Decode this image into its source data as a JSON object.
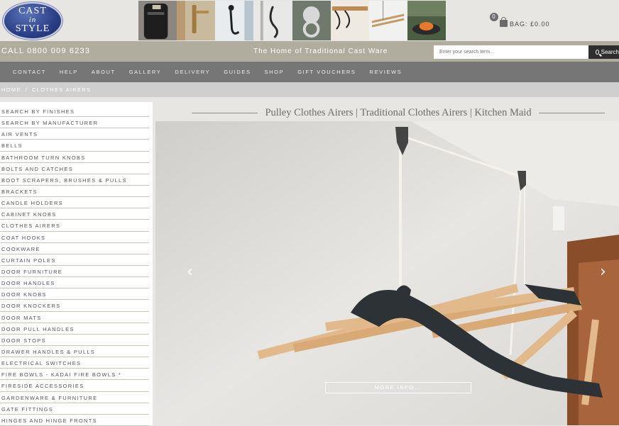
{
  "logo": {
    "line1": "CAST",
    "line2": "in",
    "line3": "STYLE"
  },
  "bag": {
    "count": "0",
    "label": "BAG: £0.00"
  },
  "strip": {
    "phone": "CALL 0800 009 6233",
    "tagline": "The Home of Traditional Cast Ware",
    "search_placeholder": "Enter your search term...",
    "search_button": "Search"
  },
  "nav": [
    "CONTACT",
    "HELP",
    "ABOUT",
    "GALLERY",
    "DELIVERY",
    "GUIDES",
    "SHOP",
    "GIFT VOUCHERS",
    "REVIEWS"
  ],
  "breadcrumb": {
    "home": "HOME",
    "sep": "/",
    "current": "CLOTHES AIRERS"
  },
  "sidebar": [
    "SEARCH BY FINISHES",
    "SEARCH BY MANUFACTURER",
    "AIR VENTS",
    "BELLS",
    "BATHROOM TURN KNOBS",
    "BOLTS AND CATCHES",
    "BOOT SCRAPERS, BRUSHES & PULLS",
    "BRACKETS",
    "CANDLE HOLDERS",
    "CABINET KNOBS",
    "CLOTHES AIRERS",
    "COAT HOOKS",
    "COOKWARE",
    "CURTAIN POLES",
    "DOOR FURNITURE",
    "DOOR HANDLES",
    "DOOR KNOBS",
    "DOOR KNOCKERS",
    "DOOR MATS",
    "DOOR PULL HANDLES",
    "DOOR STOPS",
    "DRAWER HANDLES & PULLS",
    "ELECTRICAL SWITCHES",
    "FIRE BOWLS - KADAI FIRE BOWLS *",
    "FIRESIDE ACCESSORIES",
    "GARDENWARE & FURNITURE",
    "GATE FITTINGS",
    "HINGES AND HINGE FRONTS"
  ],
  "heading": "Pulley Clothes Airers | Traditional Clothes Airers | Kitchen Maid",
  "hero": {
    "more_label": "MORE INFO...",
    "prev_arrow": "‹",
    "next_arrow": "›"
  },
  "colors": {
    "strip": "#b1ad9e",
    "nav": "#767676",
    "search_button": "#2e2e2e",
    "logo_blue": "#2a3f86"
  },
  "icons": [
    "search-icon",
    "bag-icon",
    "chevron-left-icon",
    "chevron-right-icon"
  ]
}
